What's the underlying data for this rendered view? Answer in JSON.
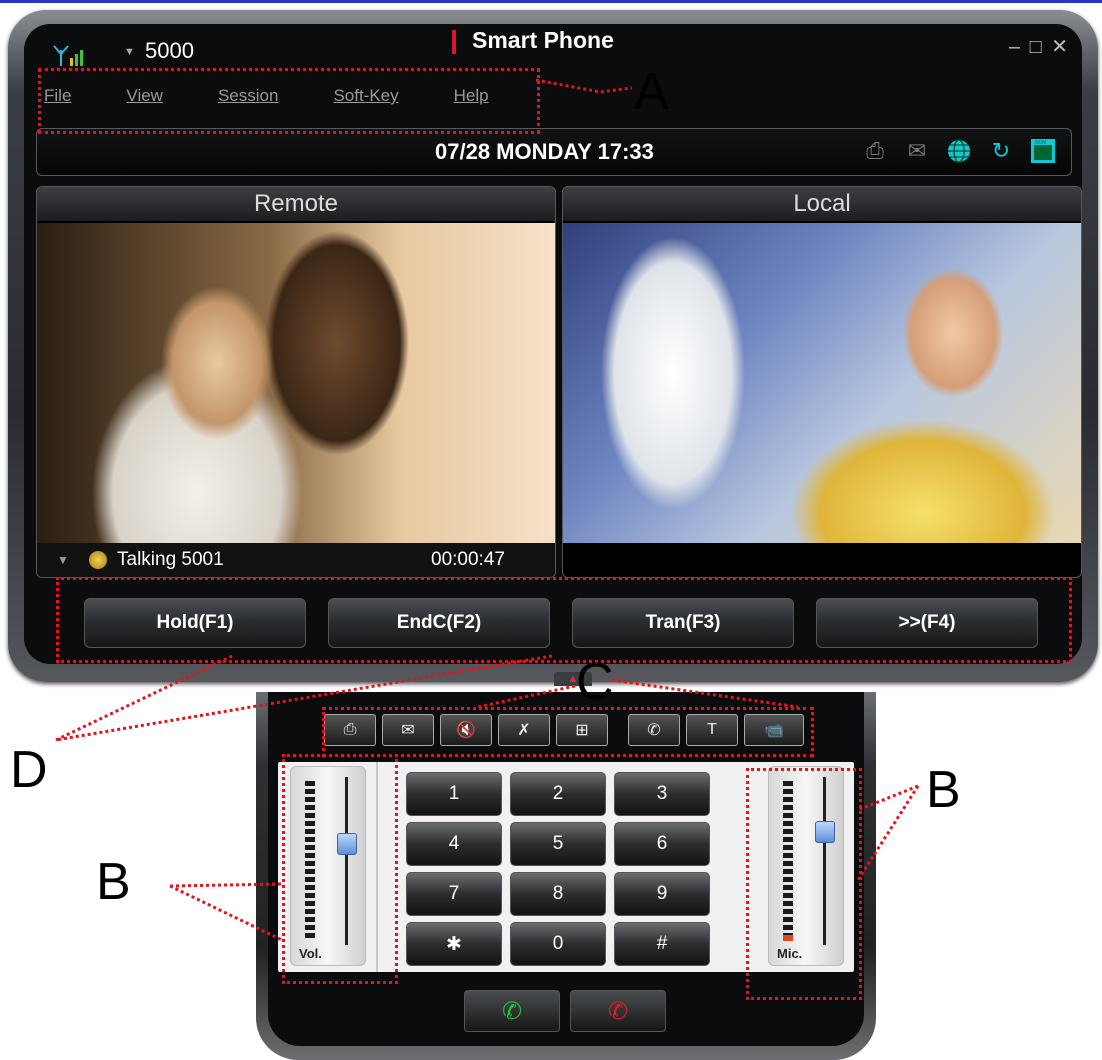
{
  "window": {
    "extension": "5000",
    "app_title": "Smart Phone",
    "controls": {
      "minimize": "–",
      "maximize": "□",
      "close": "✕"
    }
  },
  "menu": {
    "items": [
      {
        "label": "File"
      },
      {
        "label": "View"
      },
      {
        "label": "Session"
      },
      {
        "label": "Soft-Key"
      },
      {
        "label": "Help"
      }
    ]
  },
  "status": {
    "datetime": "07/28 MONDAY 17:33",
    "icons": [
      {
        "name": "contacts-icon",
        "glyph": "⎙",
        "active": false
      },
      {
        "name": "mail-icon",
        "glyph": "✉",
        "active": false
      },
      {
        "name": "globe-icon",
        "glyph": "🌐",
        "active": true
      },
      {
        "name": "refresh-icon",
        "glyph": "↻",
        "active": true
      },
      {
        "name": "num-lock-icon",
        "glyph": "⌨",
        "active": true
      }
    ],
    "active_color": "#10c9d8"
  },
  "video": {
    "remote_label": "Remote",
    "local_label": "Local",
    "call_state": "Talking 5001",
    "call_timer": "00:00:47"
  },
  "softkeys": [
    "Hold(F1)",
    "EndC(F2)",
    "Tran(F3)",
    ">>(F4)"
  ],
  "function_bar": [
    {
      "name": "contacts-icon",
      "glyph": "⎙"
    },
    {
      "name": "mail-icon",
      "glyph": "✉"
    },
    {
      "name": "mute-speaker-icon",
      "glyph": "🔇"
    },
    {
      "name": "tools-icon",
      "glyph": "✗"
    },
    {
      "name": "grid-icon",
      "glyph": "⊞"
    },
    {
      "name": "call-settings-icon",
      "glyph": "✆"
    },
    {
      "name": "text-input-icon",
      "glyph": "T"
    },
    {
      "name": "video-camera-icon",
      "glyph": "📹"
    }
  ],
  "keypad": {
    "keys": [
      "1",
      "2",
      "3",
      "4",
      "5",
      "6",
      "7",
      "8",
      "9",
      "✱",
      "0",
      "#"
    ]
  },
  "sliders": {
    "volume": {
      "label": "Vol.",
      "level": 0.38
    },
    "mic": {
      "label": "Mic.",
      "level": 0.3
    }
  },
  "call_buttons": {
    "answer_glyph": "✆",
    "reject_glyph": "✆"
  },
  "annotations": {
    "A": "A",
    "B_left": "B",
    "B_right": "B",
    "C": "C",
    "D": "D",
    "color": "#e3141e"
  }
}
